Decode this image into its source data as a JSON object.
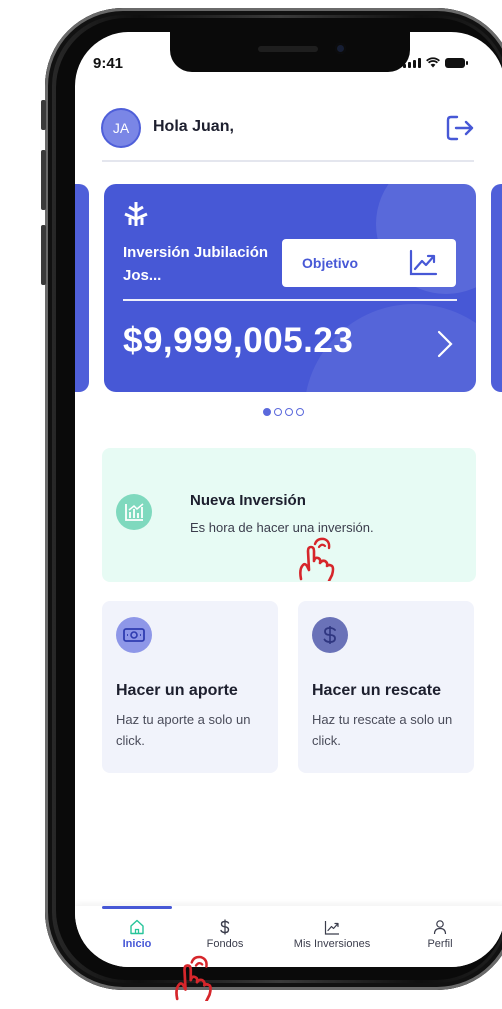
{
  "status_bar": {
    "time": "9:41"
  },
  "header": {
    "avatar_initials": "JA",
    "greeting": "Hola Juan,"
  },
  "card": {
    "fund_name": "Inversión Jubilación Jos...",
    "objective_label": "Objetivo",
    "amount": "$9,999,005.23",
    "color": "#4758d6"
  },
  "carousel": {
    "pages": 4,
    "active_index": 0
  },
  "new_investment": {
    "title": "Nueva Inversión",
    "description": "Es hora de hacer una inversión."
  },
  "actions": {
    "contribution": {
      "title": "Hacer un aporte",
      "description": "Haz tu aporte a solo un click."
    },
    "redemption": {
      "title": "Hacer un rescate",
      "description": "Haz tu rescate a solo un click."
    }
  },
  "tabs": [
    {
      "label": "Inicio",
      "icon": "home-icon",
      "active": true
    },
    {
      "label": "Fondos",
      "icon": "dollar-icon",
      "active": false
    },
    {
      "label": "Mis Inversiones",
      "icon": "chart-icon",
      "active": false
    },
    {
      "label": "Perfil",
      "icon": "person-icon",
      "active": false
    }
  ],
  "colors": {
    "accent": "#4758d6",
    "mint": "#e7fbf4",
    "tile_bg": "#f1f3fb",
    "tap_hint": "#d6262b"
  }
}
